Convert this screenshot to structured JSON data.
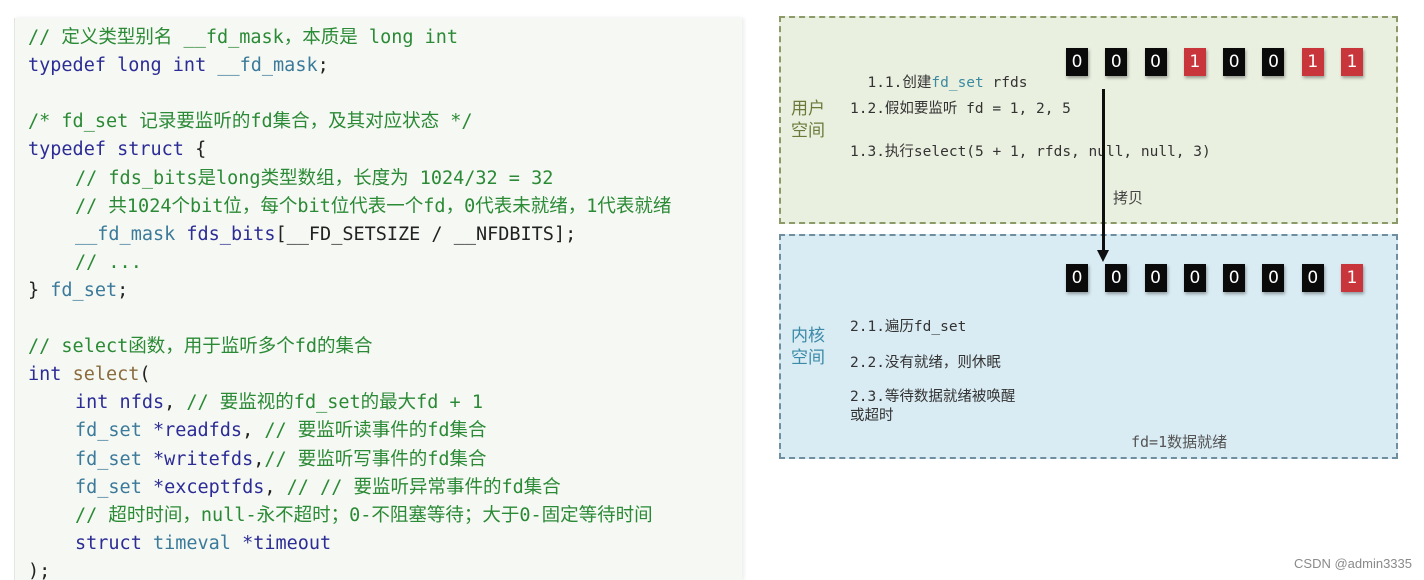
{
  "code": {
    "lines": [
      {
        "indent": false,
        "tokens": [
          {
            "c": "cm",
            "t": "// 定义类型别名 __fd_mask，本质是 long int"
          }
        ]
      },
      {
        "indent": false,
        "tokens": [
          {
            "c": "kw",
            "t": "typedef long int "
          },
          {
            "c": "ty",
            "t": "__fd_mask"
          },
          {
            "c": "pl",
            "t": ";"
          }
        ]
      },
      {
        "indent": false,
        "tokens": []
      },
      {
        "indent": false,
        "tokens": [
          {
            "c": "cm",
            "t": "/* fd_set 记录要监听的fd集合，及其对应状态 */"
          }
        ]
      },
      {
        "indent": false,
        "tokens": [
          {
            "c": "kw",
            "t": "typedef struct "
          },
          {
            "c": "pl",
            "t": "{"
          }
        ]
      },
      {
        "indent": true,
        "tokens": [
          {
            "c": "cm",
            "t": "// fds_bits是long类型数组，长度为 1024/32 = 32"
          }
        ]
      },
      {
        "indent": true,
        "tokens": [
          {
            "c": "cm",
            "t": "// 共1024个bit位，每个bit位代表一个fd，0代表未就绪，1代表就绪"
          }
        ]
      },
      {
        "indent": true,
        "tokens": [
          {
            "c": "ty",
            "t": "__fd_mask "
          },
          {
            "c": "kw",
            "t": "fds_bits"
          },
          {
            "c": "pl",
            "t": "[__FD_SETSIZE / __NFDBITS];"
          }
        ]
      },
      {
        "indent": true,
        "tokens": [
          {
            "c": "cm",
            "t": "// ..."
          }
        ]
      },
      {
        "indent": false,
        "tokens": [
          {
            "c": "pl",
            "t": "} "
          },
          {
            "c": "ty",
            "t": "fd_set"
          },
          {
            "c": "pl",
            "t": ";"
          }
        ]
      },
      {
        "indent": false,
        "tokens": []
      },
      {
        "indent": false,
        "tokens": [
          {
            "c": "cm",
            "t": "// select函数，用于监听多个fd的集合"
          }
        ]
      },
      {
        "indent": false,
        "tokens": [
          {
            "c": "kw",
            "t": "int "
          },
          {
            "c": "fn",
            "t": "select"
          },
          {
            "c": "pl",
            "t": "("
          }
        ]
      },
      {
        "indent": true,
        "tokens": [
          {
            "c": "kw",
            "t": "int nfds"
          },
          {
            "c": "pl",
            "t": ", "
          },
          {
            "c": "cm",
            "t": "// 要监视的fd_set的最大fd + 1"
          }
        ]
      },
      {
        "indent": true,
        "tokens": [
          {
            "c": "ty",
            "t": "fd_set "
          },
          {
            "c": "kw",
            "t": "*readfds"
          },
          {
            "c": "pl",
            "t": ", "
          },
          {
            "c": "cm",
            "t": "// 要监听读事件的fd集合"
          }
        ]
      },
      {
        "indent": true,
        "tokens": [
          {
            "c": "ty",
            "t": "fd_set "
          },
          {
            "c": "kw",
            "t": "*writefds"
          },
          {
            "c": "pl",
            "t": ","
          },
          {
            "c": "cm",
            "t": "// 要监听写事件的fd集合"
          }
        ]
      },
      {
        "indent": true,
        "tokens": [
          {
            "c": "ty",
            "t": "fd_set "
          },
          {
            "c": "kw",
            "t": "*exceptfds"
          },
          {
            "c": "pl",
            "t": ", "
          },
          {
            "c": "cm",
            "t": "// // 要监听异常事件的fd集合"
          }
        ]
      },
      {
        "indent": true,
        "tokens": [
          {
            "c": "cm",
            "t": "// 超时时间，null-永不超时；0-不阻塞等待；大于0-固定等待时间"
          }
        ]
      },
      {
        "indent": true,
        "tokens": [
          {
            "c": "kw",
            "t": "struct "
          },
          {
            "c": "ty",
            "t": "timeval "
          },
          {
            "c": "kw",
            "t": "*timeout"
          }
        ]
      },
      {
        "indent": false,
        "tokens": [
          {
            "c": "pl",
            "t": ");"
          }
        ]
      }
    ]
  },
  "diagram": {
    "user_space": {
      "label": "用户空间",
      "steps": [
        {
          "prefix": "1.1.创建",
          "highlight": "fd_set",
          "suffix": " rfds"
        },
        {
          "prefix": "1.2.假如要监听 fd = 1, 2, 5",
          "highlight": "",
          "suffix": ""
        },
        {
          "prefix": "1.3.执行select(5 + 1, rfds, null, null, 3)",
          "highlight": "",
          "suffix": ""
        }
      ],
      "bits": [
        0,
        0,
        0,
        1,
        0,
        0,
        1,
        1
      ]
    },
    "copy_label": "拷贝",
    "kernel_space": {
      "label": "内核空间",
      "steps": [
        "2.1.遍历fd_set",
        "2.2.没有就绪，则休眠",
        "2.3.等待数据就绪被唤醒\n或超时"
      ],
      "bits": [
        0,
        0,
        0,
        0,
        0,
        0,
        0,
        1
      ],
      "ready_label": "fd=1数据就绪"
    },
    "colors": {
      "bit_zero": "#0a0a0a",
      "bit_one": "#c8353a",
      "user_space_bg": "#eaf0e0",
      "kernel_space_bg": "#d9ebf3"
    }
  },
  "watermark": "CSDN @admin3335"
}
